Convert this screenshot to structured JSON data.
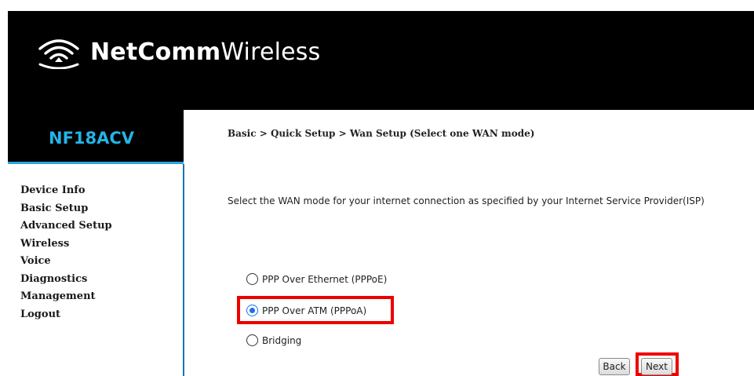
{
  "header": {
    "brand_bold": "NetComm",
    "brand_light": "Wireless",
    "logo_icon": "wifi-icon"
  },
  "sidebar": {
    "model": "NF18ACV",
    "items": [
      {
        "label": "Device Info"
      },
      {
        "label": "Basic Setup"
      },
      {
        "label": "Advanced Setup"
      },
      {
        "label": "Wireless"
      },
      {
        "label": "Voice"
      },
      {
        "label": "Diagnostics"
      },
      {
        "label": "Management"
      },
      {
        "label": "Logout"
      }
    ]
  },
  "main": {
    "breadcrumb": "Basic > Quick Setup > Wan Setup (Select one WAN mode)",
    "description": "Select the WAN mode for your internet connection as specified by your Internet Service Provider(ISP)",
    "options": [
      {
        "label": "PPP Over Ethernet (PPPoE)",
        "checked": false
      },
      {
        "label": "PPP Over ATM (PPPoA)",
        "checked": true
      },
      {
        "label": "Bridging",
        "checked": false
      }
    ],
    "back_label": "Back",
    "next_label": "Next"
  },
  "colors": {
    "accent": "#2ba6de",
    "highlight": "#ee0000",
    "header_bg": "#000000"
  }
}
